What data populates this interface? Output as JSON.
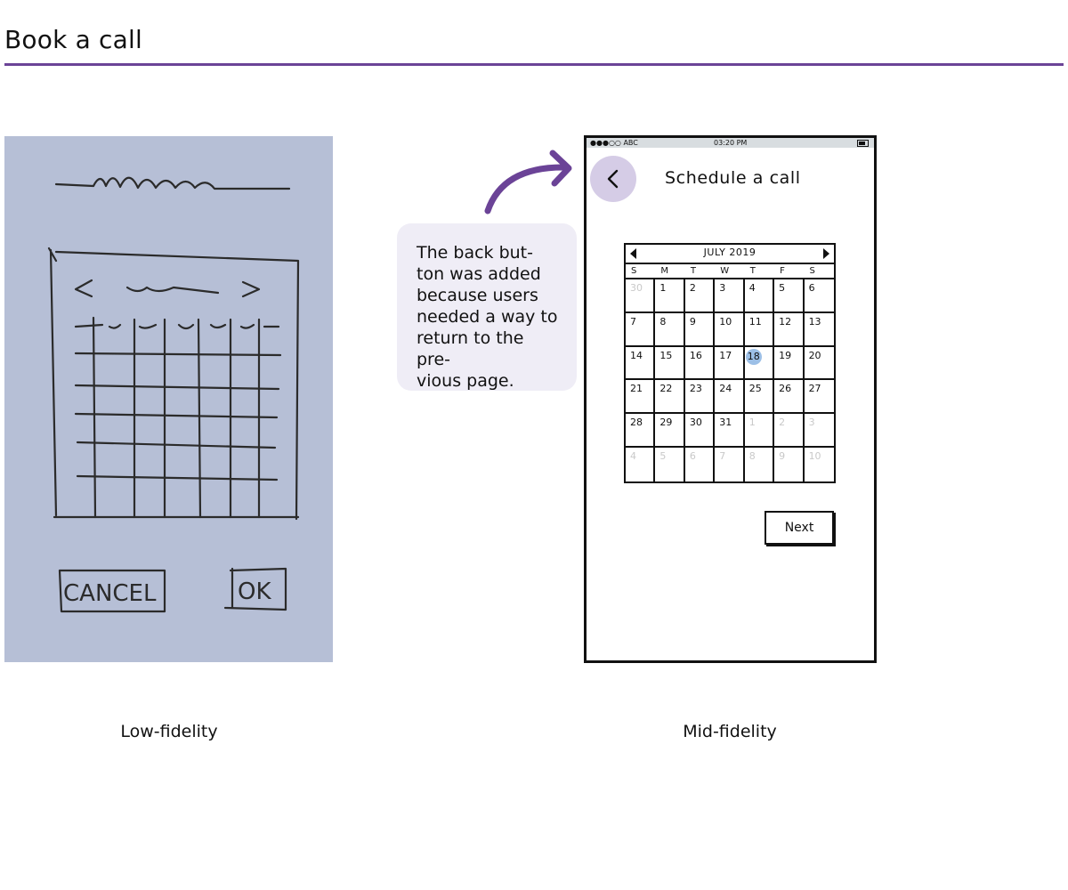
{
  "page": {
    "title": "Book a call"
  },
  "low_fi": {
    "caption": "Low-fidelity",
    "sketch_labels": {
      "cancel": "CANCEL",
      "ok": "OK"
    }
  },
  "mid_fi": {
    "caption": "Mid-fidelity",
    "status_bar": {
      "carrier": "●●●○○ ABC",
      "time": "03:20 PM"
    },
    "screen_title": "Schedule a call",
    "calendar": {
      "month_label": "JULY 2019",
      "weekdays": [
        "S",
        "M",
        "T",
        "W",
        "T",
        "F",
        "S"
      ],
      "days": [
        "30",
        "1",
        "2",
        "3",
        "4",
        "5",
        "6",
        "7",
        "8",
        "9",
        "10",
        "11",
        "12",
        "13",
        "14",
        "15",
        "16",
        "17",
        "18",
        "19",
        "20",
        "21",
        "22",
        "23",
        "24",
        "25",
        "26",
        "27",
        "28",
        "29",
        "30",
        "31",
        "1",
        "2",
        "3",
        "4",
        "5",
        "6",
        "7",
        "8",
        "9",
        "10"
      ],
      "muted_indices": [
        0,
        32,
        33,
        34,
        35,
        36,
        37,
        38,
        39,
        40,
        41
      ],
      "selected_day": "18"
    },
    "next_label": "Next"
  },
  "annotation": {
    "text": "The back but-\nton was added\nbecause users\nneeded a way to\nreturn to the pre-\nvious page."
  },
  "colors": {
    "accent": "#6b4397",
    "back_button_bg": "#d5cce6",
    "selected_day_bg": "#9cbfe6",
    "note_bg": "#efedf6"
  }
}
